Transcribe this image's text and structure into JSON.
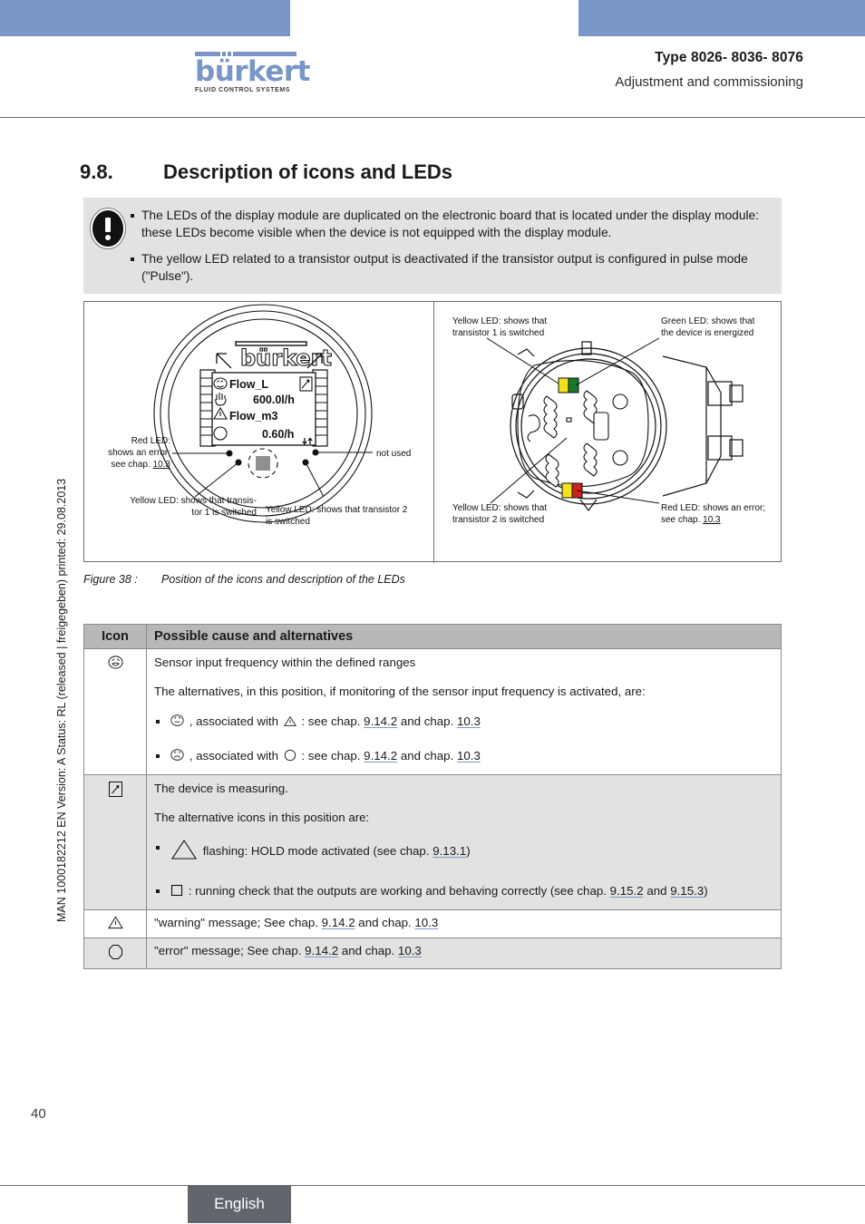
{
  "header": {
    "logo_word": "bürkert",
    "logo_subtitle": "FLUID CONTROL SYSTEMS",
    "type_line": "Type 8026- 8036- 8076",
    "subtitle": "Adjustment and commissioning"
  },
  "margin_note": "MAN 1000182212  EN  Version: A  Status: RL (released | freigegeben)  printed: 29.08.2013",
  "section": {
    "number": "9.8.",
    "title": "Description of icons and LEDs"
  },
  "note_box": {
    "icon": "exclamation-circle-icon",
    "items": [
      "The LEDs of the display module are duplicated on the electronic board that is located under the display module: these LEDs become visible when the device is not equipped with the display module.",
      "The yellow LED related to a transistor output is deactivated if the transistor output is configured in pulse mode (\"Pulse\")."
    ]
  },
  "figure": {
    "caption_label": "Figure 38 :",
    "caption_text": "Position of the icons and description of the LEDs",
    "display_module": {
      "brand": "bürkert",
      "line1_label": "Flow_L",
      "line1_value": "600.0l/h",
      "line2_label": "Flow_m3",
      "line2_value": "0.60/h",
      "icons": [
        "smiley-icon",
        "hand-icon",
        "warning-triangle-icon",
        "octagon-icon",
        "gauge-icon"
      ]
    },
    "left_callouts": [
      {
        "name": "red-led-callout",
        "lines": [
          "Red LED:",
          "shows an error;",
          "see chap. 10.3"
        ],
        "ref": "10.3"
      },
      {
        "name": "not-used-callout",
        "lines": [
          "not used"
        ]
      },
      {
        "name": "yellow-led-1-callout",
        "lines": [
          "Yellow LED: shows that transis-",
          "tor 1 is switched"
        ]
      },
      {
        "name": "yellow-led-2-callout",
        "lines": [
          "Yellow LED: shows that transistor 2",
          "is switched"
        ]
      }
    ],
    "right_callouts": [
      {
        "name": "yellow-led-1-callout",
        "lines": [
          "Yellow LED: shows that",
          "transistor 1 is switched"
        ]
      },
      {
        "name": "green-led-callout",
        "lines": [
          "Green LED: shows that",
          "the device is energized"
        ]
      },
      {
        "name": "yellow-led-2-callout",
        "lines": [
          "Yellow LED: shows that",
          "transistor 2 is switched"
        ]
      },
      {
        "name": "red-led-callout",
        "lines": [
          "Red LED: shows an error;",
          "see chap. 10.3"
        ],
        "ref": "10.3"
      }
    ],
    "led_colors": {
      "yellow": "#f2e11c",
      "green": "#157a2e",
      "red": "#cf1f1f"
    }
  },
  "table": {
    "headers": [
      "Icon",
      "Possible cause and alternatives"
    ],
    "rows": [
      {
        "icon": "smiley-happy-icon",
        "shaded": false,
        "paragraphs": [
          "Sensor input frequency within the defined ranges",
          "The alternatives, in this position, if monitoring of the sensor input frequency is activated, are:"
        ],
        "bullets": [
          {
            "icon_a": "smiley-neutral-icon",
            "mid": ", associated with",
            "icon_b": "warning-triangle-icon",
            "text": ": see chap. 9.14.2 and chap. 10.3",
            "text_pre": ": see chap. ",
            "ref1": "9.14.2",
            "text_mid": " and chap. ",
            "ref2": "10.3"
          },
          {
            "icon_a": "smiley-sad-icon",
            "mid": ", associated with",
            "icon_b": "octagon-icon",
            "text": ": see chap. 9.14.2 and chap. 10.3",
            "text_pre": ": see chap. ",
            "ref1": "9.14.2",
            "text_mid": " and chap. ",
            "ref2": "10.3"
          }
        ]
      },
      {
        "icon": "gauge-icon",
        "shaded": true,
        "paragraphs": [
          "The device is measuring.",
          "The alternative icons in this position are:"
        ],
        "bullets": [
          {
            "icon_a": "triangle-outline-icon",
            "text_pre": "flashing: HOLD mode activated (see chap. ",
            "ref1": "9.13.1",
            "text_post": ")"
          },
          {
            "icon_a": "square-outline-icon",
            "text_pre": ": running check that the outputs are working and behaving correctly (see chap. ",
            "ref1": "9.15.2",
            "text_mid": " and ",
            "ref2": "9.15.3",
            "text_post": ")"
          }
        ]
      },
      {
        "icon": "warning-triangle-icon",
        "shaded": false,
        "simple_pre": "\"warning\" message; See chap. ",
        "ref1": "9.14.2",
        "simple_mid": " and chap. ",
        "ref2": "10.3"
      },
      {
        "icon": "octagon-icon",
        "shaded": true,
        "simple_pre": "\"error\" message; See chap. ",
        "ref1": "9.14.2",
        "simple_mid": " and chap. ",
        "ref2": "10.3"
      }
    ]
  },
  "footer": {
    "page_number": "40",
    "language": "English"
  },
  "colors": {
    "brand_blue": "#7a96c8",
    "note_bg": "#e2e2e2",
    "table_header_bg": "#b8b8b8",
    "row_shade": "#e2e2e2",
    "footer_tab": "#62666c",
    "link_underline": "#8099c4"
  }
}
